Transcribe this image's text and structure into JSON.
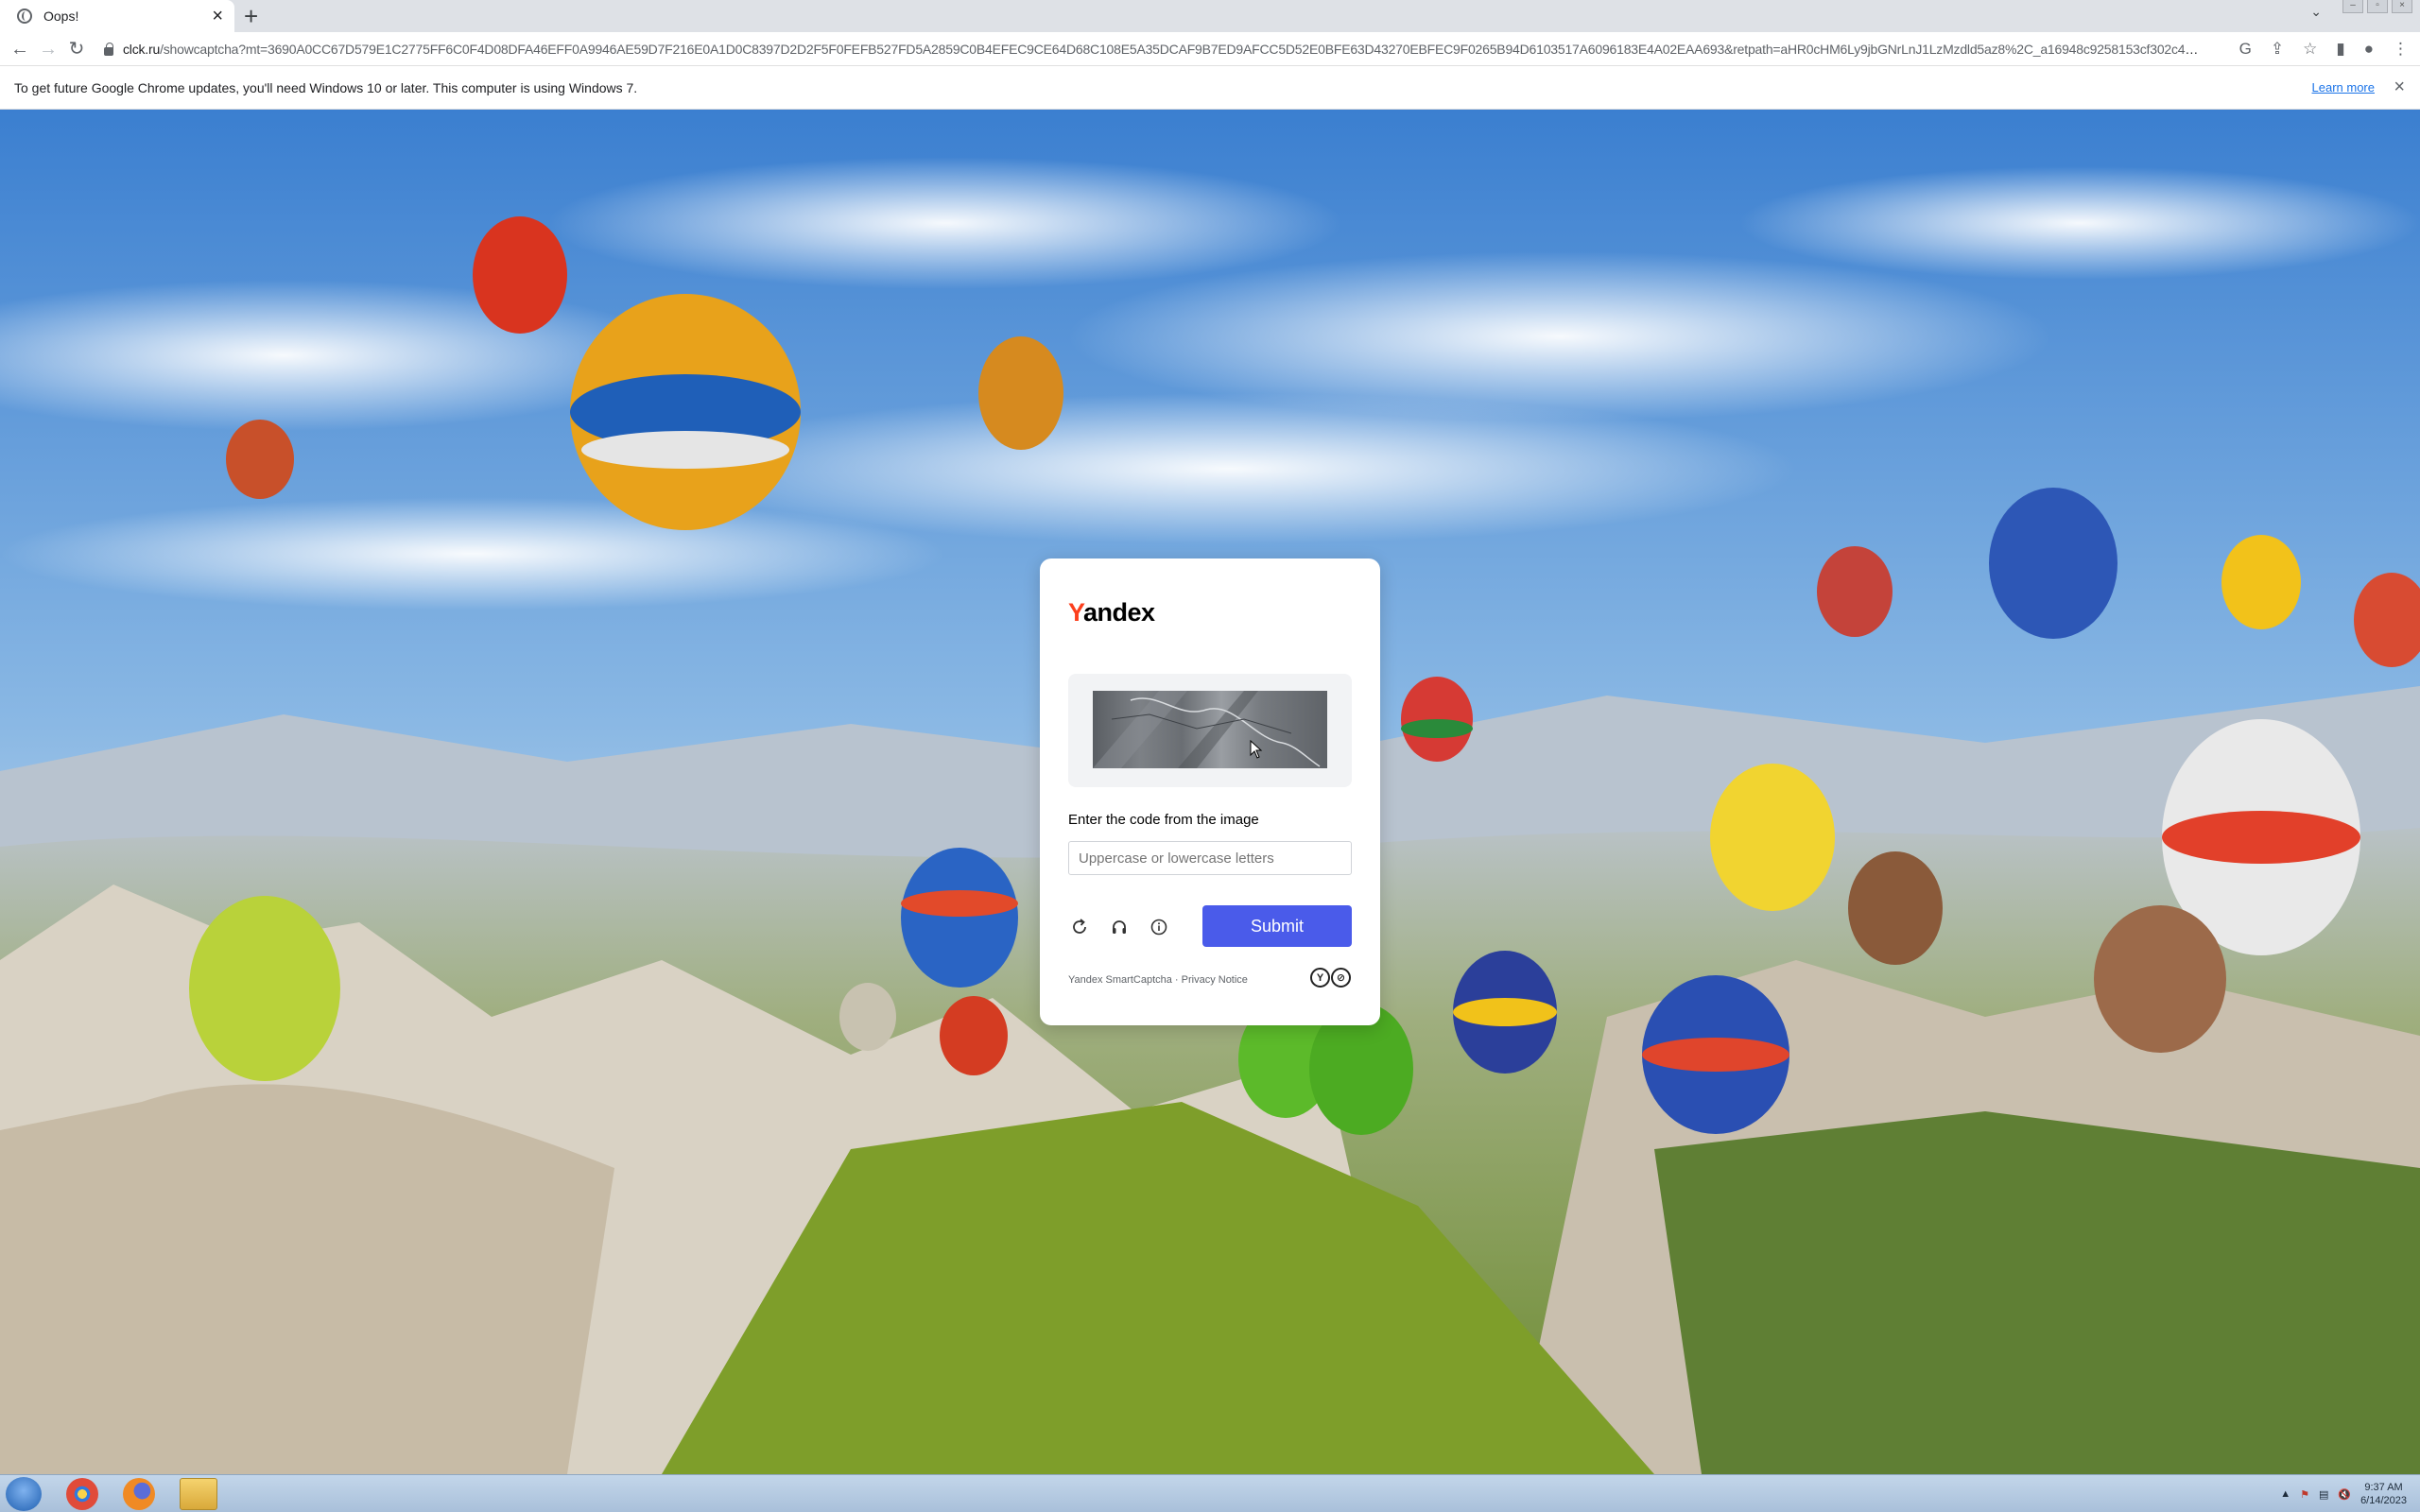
{
  "browser": {
    "tab_title": "Oops!",
    "url_domain": "clck.ru",
    "url_path": "/showcaptcha?mt=3690A0CC67D579E1C2775FF6C0F4D08DFA46EFF0A9946AE59D7F216E0A1D0C8397D2D2F5F0FEFB527FD5A2859C0B4EFEC9CE64D68C108E5A35DCAF9B7ED9AFCC5D52E0BFE63D43270EBFEC9F0265B94D6103517A6096183E4A02EAA693&retpath=aHR0cHM6Ly9jbGNrLnJ1LzMzdld5az8%2C_a16948c9258153cf302c4cde35d1e58&t..."
  },
  "infobar": {
    "message": "To get future Google Chrome updates, you'll need Windows 10 or later. This computer is using Windows 7.",
    "learn_more": "Learn more"
  },
  "captcha": {
    "logo_first": "Y",
    "logo_rest": "andex",
    "prompt": "Enter the code from the image",
    "input_placeholder": "Uppercase or lowercase letters",
    "submit_label": "Submit",
    "footer": "Yandex SmartCaptcha · Privacy Notice"
  },
  "taskbar": {
    "time": "9:37 AM",
    "date": "6/14/2023"
  },
  "colors": {
    "brand_red": "#fc3f1d",
    "submit_blue": "#4a5bea",
    "link_blue": "#1a73e8"
  }
}
